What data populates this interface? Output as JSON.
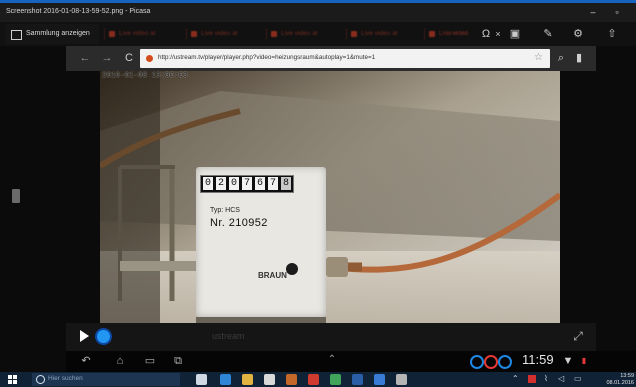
{
  "window": {
    "title": "Screenshot 2016-01-08-13-59-52.png - Picasa",
    "controls": [
      "minimize-icon",
      "maximize-icon"
    ]
  },
  "browser": {
    "active_tab": {
      "label": "Sammlung anzeigen",
      "icon": "gallery-icon"
    },
    "tabs": [
      {
        "label": "Live video at"
      },
      {
        "label": "Live video at"
      },
      {
        "label": "Live video at"
      },
      {
        "label": "Live video at"
      },
      {
        "label": "Live video"
      },
      {
        "label": "Live vid"
      }
    ],
    "toolbar_icons": [
      "omega-icon",
      "close-icon",
      "photo-icon",
      "pencil-icon",
      "settings-icon",
      "share-icon"
    ],
    "nav": {
      "back": "back-arrow-icon",
      "forward": "forward-arrow-icon",
      "reload": "reload-icon"
    },
    "url": "http://ustream.tv/player/player.php?video=heizungsraum&autoplay=1&mute=1",
    "url_actions": [
      "star-icon",
      "search-icon",
      "bookmark-icon"
    ]
  },
  "video": {
    "timestamp": "2016-01-08 13:00:03",
    "meter_digits": [
      "0",
      "2",
      "0",
      "7",
      "6",
      "7",
      "8"
    ],
    "meter_model": "Typ: HCS",
    "meter_serial": "Nr. 210952",
    "meter_brand": "BRAUN",
    "watermark": "ustream",
    "state": "paused"
  },
  "controls": {
    "play": "play-icon",
    "progress": 0.0,
    "fullscreen": "fullscreen-icon"
  },
  "system_bar": {
    "clock": "11:59",
    "buttons": [
      "back-icon",
      "home-icon",
      "recent-apps-icon",
      "screenshot-icon"
    ]
  },
  "taskbar": {
    "search_placeholder": "Hier suchen",
    "tray_time": "13:59",
    "tray_date": "08.01.2016",
    "apps": [
      {
        "name": "task-view",
        "color": "#cfd8e3"
      },
      {
        "name": "edge",
        "color": "#2f86d7"
      },
      {
        "name": "explorer",
        "color": "#e3b341"
      },
      {
        "name": "store",
        "color": "#d9d9d9"
      },
      {
        "name": "paint",
        "color": "#c4682a"
      },
      {
        "name": "chrome",
        "color": "#d13b2f"
      },
      {
        "name": "maps",
        "color": "#40a55a"
      },
      {
        "name": "mail",
        "color": "#2a5fa8"
      },
      {
        "name": "calc",
        "color": "#3a7bd5"
      },
      {
        "name": "picasa",
        "color": "#b5b5b5"
      }
    ]
  },
  "colors": {
    "accent_blue": "#1565c0",
    "progress_knob": "#2196f3",
    "pipe_copper": "#b5683a",
    "background": "#0b0b0b"
  }
}
